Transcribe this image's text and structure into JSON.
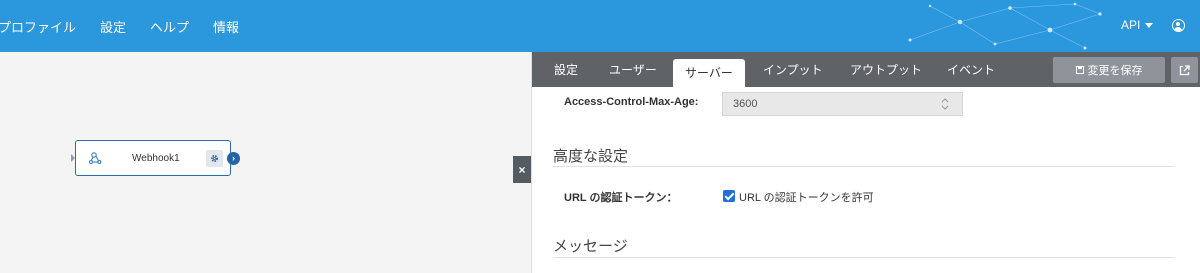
{
  "nav": {
    "items": [
      {
        "label": "プロファイル"
      },
      {
        "label": "設定"
      },
      {
        "label": "ヘルプ"
      },
      {
        "label": "情報"
      }
    ],
    "api_label": "API"
  },
  "canvas": {
    "node": {
      "label": "Webhook1",
      "icon": "webhook-icon"
    },
    "close_label": "×"
  },
  "panel": {
    "tabs": [
      {
        "label": "設定",
        "active": false
      },
      {
        "label": "ユーザー",
        "active": false
      },
      {
        "label": "サーバー",
        "active": true
      },
      {
        "label": "インプット",
        "active": false
      },
      {
        "label": "アウトプット",
        "active": false
      },
      {
        "label": "イベント",
        "active": false
      }
    ],
    "save_label": "変更を保存",
    "max_age": {
      "label": "Access-Control-Max-Age:",
      "value": "3600"
    },
    "advanced": {
      "title": "高度な設定",
      "auth_label": "URL の認証トークン：",
      "auth_checkbox_label": "URL の認証トークンを許可",
      "auth_checked": true
    },
    "messages_title": "メッセージ"
  },
  "colors": {
    "header": "#2b97dd",
    "tabbar": "#5f6368",
    "accent": "#1e6fd9"
  }
}
